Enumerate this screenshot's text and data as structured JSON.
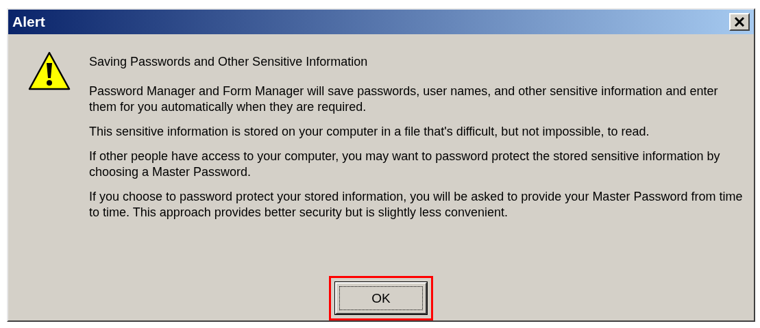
{
  "window": {
    "title": "Alert"
  },
  "heading": "Saving Passwords and Other Sensitive Information",
  "paragraphs": [
    "Password Manager and Form Manager will save passwords, user names, and other sensitive information and enter them for you automatically when they are required.",
    "This sensitive information is stored on your computer in a file that's difficult, but not impossible, to read.",
    "If other people have access to your computer, you may want to password protect the stored sensitive information by choosing a Master Password.",
    "If you choose to password protect your stored information, you will be asked to provide your Master Password from time to time. This approach provides better security but is slightly less convenient."
  ],
  "ok_button": {
    "label": "OK",
    "highlighted": true
  }
}
